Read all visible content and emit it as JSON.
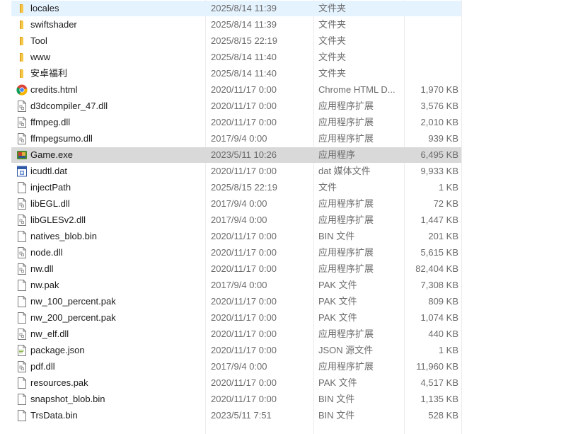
{
  "files": [
    {
      "name": "locales",
      "date": "2025/8/14 11:39",
      "type": "文件夹",
      "size": "",
      "icon": "folder-icon",
      "state": "selected"
    },
    {
      "name": "swiftshader",
      "date": "2025/8/14 11:39",
      "type": "文件夹",
      "size": "",
      "icon": "folder-icon",
      "state": ""
    },
    {
      "name": "Tool",
      "date": "2025/8/15 22:19",
      "type": "文件夹",
      "size": "",
      "icon": "folder-icon",
      "state": ""
    },
    {
      "name": "www",
      "date": "2025/8/14 11:40",
      "type": "文件夹",
      "size": "",
      "icon": "folder-icon",
      "state": ""
    },
    {
      "name": "安卓福利",
      "date": "2025/8/14 11:40",
      "type": "文件夹",
      "size": "",
      "icon": "folder-icon",
      "state": ""
    },
    {
      "name": "credits.html",
      "date": "2020/11/17 0:00",
      "type": "Chrome HTML D...",
      "size": "1,970 KB",
      "icon": "chrome-html-icon",
      "state": ""
    },
    {
      "name": "d3dcompiler_47.dll",
      "date": "2020/11/17 0:00",
      "type": "应用程序扩展",
      "size": "3,576 KB",
      "icon": "dll-file-icon",
      "state": ""
    },
    {
      "name": "ffmpeg.dll",
      "date": "2020/11/17 0:00",
      "type": "应用程序扩展",
      "size": "2,010 KB",
      "icon": "dll-file-icon",
      "state": ""
    },
    {
      "name": "ffmpegsumo.dll",
      "date": "2017/9/4 0:00",
      "type": "应用程序扩展",
      "size": "939 KB",
      "icon": "dll-file-icon",
      "state": ""
    },
    {
      "name": "Game.exe",
      "date": "2023/5/11 10:26",
      "type": "应用程序",
      "size": "6,495 KB",
      "icon": "game-exe-icon",
      "state": "hover"
    },
    {
      "name": "icudtl.dat",
      "date": "2020/11/17 0:00",
      "type": "dat 媒体文件",
      "size": "9,933 KB",
      "icon": "media-file-icon",
      "state": ""
    },
    {
      "name": "injectPath",
      "date": "2025/8/15 22:19",
      "type": "文件",
      "size": "1 KB",
      "icon": "blank-file-icon",
      "state": ""
    },
    {
      "name": "libEGL.dll",
      "date": "2017/9/4 0:00",
      "type": "应用程序扩展",
      "size": "72 KB",
      "icon": "dll-file-icon",
      "state": ""
    },
    {
      "name": "libGLESv2.dll",
      "date": "2017/9/4 0:00",
      "type": "应用程序扩展",
      "size": "1,447 KB",
      "icon": "dll-file-icon",
      "state": ""
    },
    {
      "name": "natives_blob.bin",
      "date": "2020/11/17 0:00",
      "type": "BIN 文件",
      "size": "201 KB",
      "icon": "blank-file-icon",
      "state": ""
    },
    {
      "name": "node.dll",
      "date": "2020/11/17 0:00",
      "type": "应用程序扩展",
      "size": "5,615 KB",
      "icon": "dll-file-icon",
      "state": ""
    },
    {
      "name": "nw.dll",
      "date": "2020/11/17 0:00",
      "type": "应用程序扩展",
      "size": "82,404 KB",
      "icon": "dll-file-icon",
      "state": ""
    },
    {
      "name": "nw.pak",
      "date": "2017/9/4 0:00",
      "type": "PAK 文件",
      "size": "7,308 KB",
      "icon": "blank-file-icon",
      "state": ""
    },
    {
      "name": "nw_100_percent.pak",
      "date": "2020/11/17 0:00",
      "type": "PAK 文件",
      "size": "809 KB",
      "icon": "blank-file-icon",
      "state": ""
    },
    {
      "name": "nw_200_percent.pak",
      "date": "2020/11/17 0:00",
      "type": "PAK 文件",
      "size": "1,074 KB",
      "icon": "blank-file-icon",
      "state": ""
    },
    {
      "name": "nw_elf.dll",
      "date": "2020/11/17 0:00",
      "type": "应用程序扩展",
      "size": "440 KB",
      "icon": "dll-file-icon",
      "state": ""
    },
    {
      "name": "package.json",
      "date": "2020/11/17 0:00",
      "type": "JSON 源文件",
      "size": "1 KB",
      "icon": "json-file-icon",
      "state": ""
    },
    {
      "name": "pdf.dll",
      "date": "2017/9/4 0:00",
      "type": "应用程序扩展",
      "size": "11,960 KB",
      "icon": "dll-file-icon",
      "state": ""
    },
    {
      "name": "resources.pak",
      "date": "2020/11/17 0:00",
      "type": "PAK 文件",
      "size": "4,517 KB",
      "icon": "blank-file-icon",
      "state": ""
    },
    {
      "name": "snapshot_blob.bin",
      "date": "2020/11/17 0:00",
      "type": "BIN 文件",
      "size": "1,135 KB",
      "icon": "blank-file-icon",
      "state": ""
    },
    {
      "name": "TrsData.bin",
      "date": "2023/5/11 7:51",
      "type": "BIN 文件",
      "size": "528 KB",
      "icon": "blank-file-icon",
      "state": ""
    }
  ],
  "colors": {
    "selected_row": "#e5f3ff",
    "hover_row": "#d9d9d9",
    "folder": "#f4c542",
    "secondary_text": "#6b6b6b"
  }
}
